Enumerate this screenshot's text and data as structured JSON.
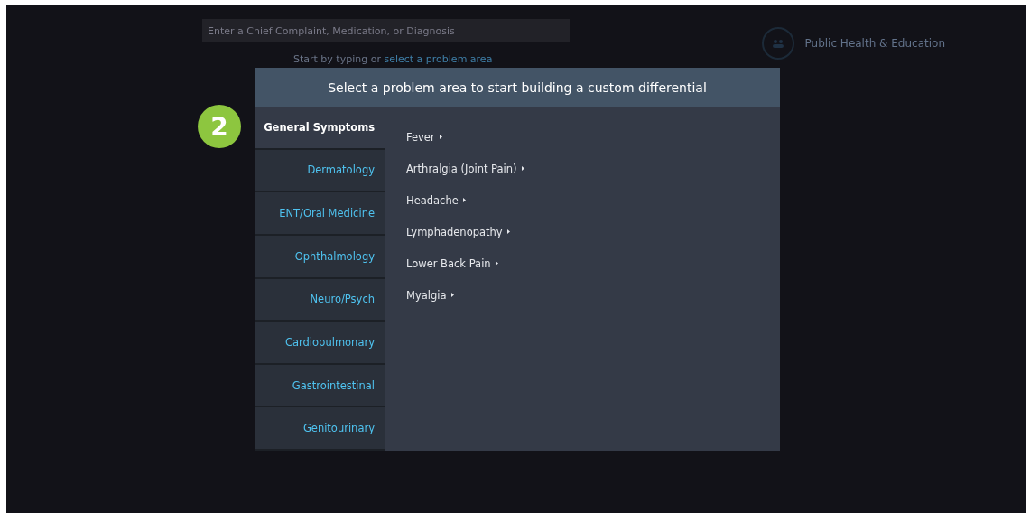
{
  "search": {
    "placeholder": "Enter a Chief Complaint, Medication, or Diagnosis"
  },
  "hint": {
    "text": "Start by typing or ",
    "link": "select a problem area"
  },
  "public_health": {
    "label": "Public Health & Education"
  },
  "step_badge": "2",
  "dialog": {
    "title": "Select a problem area to start building a custom differential",
    "categories": [
      {
        "label": "General Symptoms",
        "selected": true
      },
      {
        "label": "Dermatology",
        "selected": false
      },
      {
        "label": "ENT/Oral Medicine",
        "selected": false
      },
      {
        "label": "Ophthalmology",
        "selected": false
      },
      {
        "label": "Neuro/Psych",
        "selected": false
      },
      {
        "label": "Cardiopulmonary",
        "selected": false
      },
      {
        "label": "Gastrointestinal",
        "selected": false
      },
      {
        "label": "Genitourinary",
        "selected": false
      }
    ],
    "problems": [
      "Fever",
      "Arthralgia (Joint Pain)",
      "Headache",
      "Lymphadenopathy",
      "Lower Back Pain",
      "Myalgia"
    ]
  }
}
